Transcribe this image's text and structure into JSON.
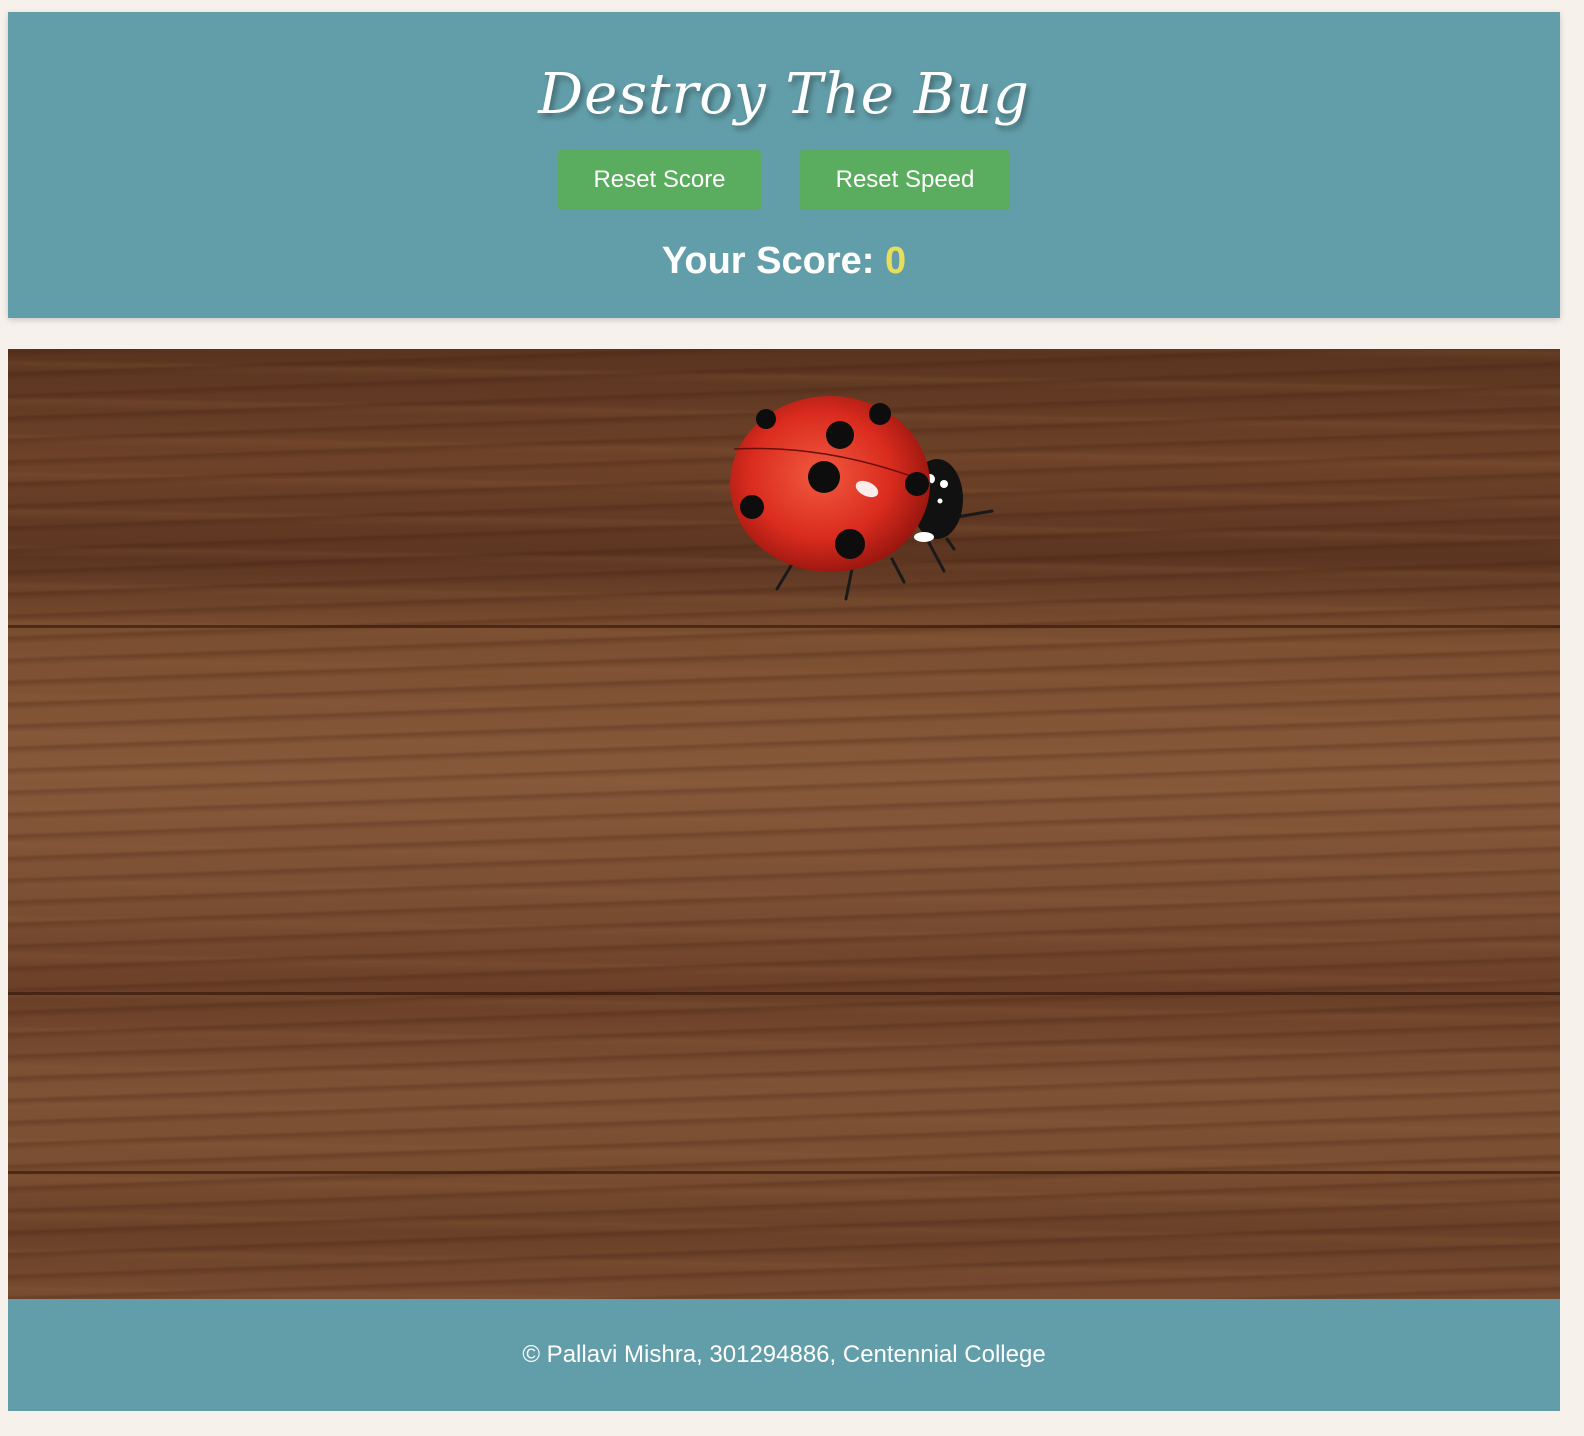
{
  "header": {
    "title": "Destroy The Bug",
    "buttons": {
      "reset_score": "Reset Score",
      "reset_speed": "Reset Speed"
    },
    "score_label": "Your Score:",
    "score_value": "0"
  },
  "board": {
    "bug_icon": "ladybug-icon"
  },
  "footer": {
    "text": "© Pallavi Mishra, 301294886, Centennial College"
  },
  "colors": {
    "header_bg": "#629ea9",
    "button_bg": "#5aad5e",
    "score_value": "#e8de5a"
  }
}
